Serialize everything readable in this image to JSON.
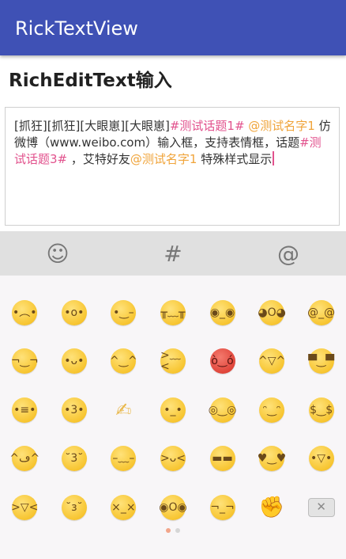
{
  "app_bar": {
    "title": "RickTextView"
  },
  "section": {
    "title": "RichEditText输入"
  },
  "editor": {
    "segments": [
      {
        "text": "[抓狂][抓狂][大眼崽][大眼崽]",
        "type": "plain"
      },
      {
        "text": "#测试话题1#",
        "type": "topic"
      },
      {
        "text": " ",
        "type": "plain"
      },
      {
        "text": "@测试名字1",
        "type": "mention"
      },
      {
        "text": " 仿微博（www.weibo.com）输入框，支持表情框，话题",
        "type": "plain"
      },
      {
        "text": "#测试话题3#",
        "type": "topic"
      },
      {
        "text": " ，艾特好友",
        "type": "plain"
      },
      {
        "text": "@测试名字1",
        "type": "mention"
      },
      {
        "text": " 特殊样式显示",
        "type": "plain"
      }
    ],
    "colors": {
      "topic": "#e2528d",
      "mention": "#f0a43a",
      "caret": "#e2528d"
    }
  },
  "tabs": [
    {
      "name": "emoji-tab",
      "icon": "smiley-icon",
      "symbol": "☺"
    },
    {
      "name": "topic-tab",
      "icon": "hash-icon",
      "symbol": "#"
    },
    {
      "name": "mention-tab",
      "icon": "at-icon",
      "symbol": "@"
    }
  ],
  "emoji_rows": [
    [
      {
        "name": "sad-sweat-emoji-icon",
        "glyph": "•︵•"
      },
      {
        "name": "hushed-emoji-icon",
        "glyph": "•o•"
      },
      {
        "name": "wink-emoji-icon",
        "glyph": "•‿–"
      },
      {
        "name": "loudly-crying-emoji-icon",
        "glyph": "╥﹏╥"
      },
      {
        "name": "flushed-emoji-icon",
        "glyph": "◉_◉"
      },
      {
        "name": "screaming-emoji-icon",
        "glyph": "◕O◕"
      },
      {
        "name": "dizzy-emoji-icon",
        "glyph": "@_@"
      }
    ],
    [
      {
        "name": "smirk-emoji-icon",
        "glyph": "¬‿¬"
      },
      {
        "name": "tongue-out-emoji-icon",
        "glyph": "•ᴗ•"
      },
      {
        "name": "blush-emoji-icon",
        "glyph": "^‿^"
      },
      {
        "name": "tired-emoji-icon",
        "glyph": ">﹏<"
      },
      {
        "name": "devil-emoji-icon",
        "glyph": "ò‿ó",
        "variant": "red"
      },
      {
        "name": "tears-of-joy-emoji-icon",
        "glyph": "^▽^"
      },
      {
        "name": "sunglasses-emoji-icon",
        "glyph": "▀‿▀"
      }
    ],
    [
      {
        "name": "zipper-mouth-emoji-icon",
        "glyph": "•≡•"
      },
      {
        "name": "kiss-heart-emoji-icon",
        "glyph": "•3•"
      },
      {
        "name": "writing-hand-emoji-icon",
        "glyph": "✍",
        "variant": "hand"
      },
      {
        "name": "confused-emoji-icon",
        "glyph": "•_•"
      },
      {
        "name": "nerd-emoji-icon",
        "glyph": "◎‿◎"
      },
      {
        "name": "halo-emoji-icon",
        "glyph": "ᵔ‿ᵔ"
      },
      {
        "name": "money-mouth-emoji-icon",
        "glyph": "$‿$"
      }
    ],
    [
      {
        "name": "yum-emoji-icon",
        "glyph": "^ڡ^"
      },
      {
        "name": "kissing-emoji-icon",
        "glyph": "˘3˘"
      },
      {
        "name": "sleepy-emoji-icon",
        "glyph": "–﹏–"
      },
      {
        "name": "squint-tongue-emoji-icon",
        "glyph": ">ᴗ<"
      },
      {
        "name": "grimacing-emoji-icon",
        "glyph": "▬▬"
      },
      {
        "name": "heart-eyes-emoji-icon",
        "glyph": "♥‿♥"
      },
      {
        "name": "grinning-emoji-icon",
        "glyph": "•▽•"
      }
    ],
    [
      {
        "name": "laughing-emoji-icon",
        "glyph": ">▽<"
      },
      {
        "name": "whistling-emoji-icon",
        "glyph": "˘з˘"
      },
      {
        "name": "thermometer-emoji-icon",
        "glyph": "×_×"
      },
      {
        "name": "astonished-emoji-icon",
        "glyph": "◉O◉"
      },
      {
        "name": "thinking-emoji-icon",
        "glyph": "¬_¬"
      },
      {
        "name": "raised-fist-emoji-icon",
        "glyph": "✊",
        "variant": "fist"
      },
      {
        "name": "backspace-icon",
        "glyph": "✕",
        "variant": "delete"
      }
    ]
  ],
  "pager": {
    "pages": 2,
    "active": 0
  }
}
